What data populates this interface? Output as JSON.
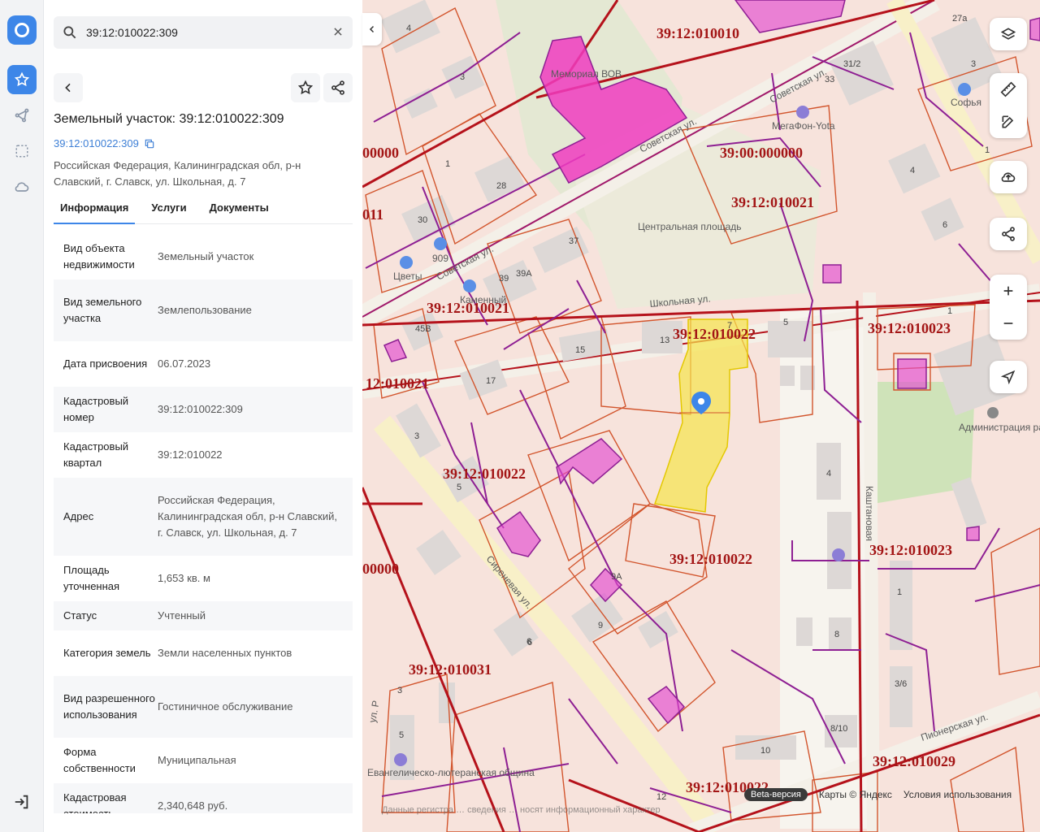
{
  "search": {
    "value": "39:12:010022:309"
  },
  "card": {
    "title": "Земельный участок: 39:12:010022:309",
    "cadastral_link": "39:12:010022:309",
    "address_line": "Российская Федерация, Калининградская обл, р-н Славский, г. Славск, ул. Школьная, д. 7"
  },
  "tabs": [
    "Информация",
    "Услуги",
    "Документы"
  ],
  "info": [
    {
      "k": "Вид объекта недвижимости",
      "v": "Земельный участок"
    },
    {
      "k": "Вид земельного участка",
      "v": "Землепользование"
    },
    {
      "k": "Дата присвоения",
      "v": "06.07.2023"
    },
    {
      "k": "Кадастровый номер",
      "v": "39:12:010022:309"
    },
    {
      "k": "Кадастровый квартал",
      "v": "39:12:010022"
    },
    {
      "k": "Адрес",
      "v": "Российская Федерация, Калининградская обл, р-н Славский, г. Славск, ул. Школьная, д. 7"
    },
    {
      "k": "Площадь уточненная",
      "v": "1,653 кв. м"
    },
    {
      "k": "Статус",
      "v": "Учтенный"
    },
    {
      "k": "Категория земель",
      "v": "Земли населенных пунктов"
    },
    {
      "k": "Вид разрешенного использования",
      "v": "Гостиничное обслуживание"
    },
    {
      "k": "Форма собственности",
      "v": "Муниципальная"
    },
    {
      "k": "Кадастровая стоимость",
      "v": "2,340,648 руб."
    }
  ],
  "map": {
    "quarters": {
      "q1": "39:12:010010",
      "q2": "39:00:000000",
      "q3": "39:12:010021",
      "q4": "39:12:010021",
      "q5": "39:12:010022",
      "q6": "39:12:010023",
      "q7": "12:010021",
      "q8": "39:12:010022",
      "q9": "39:12:010022",
      "q10": "39:12:010023",
      "q11": "39:12:010031",
      "q12": "39:12:010029",
      "q13": "39:12:010022",
      "q14": "00000",
      "q15": "011",
      "q16": "00000"
    },
    "places": {
      "memorial": "Мемориал ВОВ",
      "square": "Центральная площадь",
      "megafon": "МегаФон-Yota",
      "admin": "Администрация района",
      "church": "Евангелическо-лютеранская община",
      "sofya": "Софья",
      "tsvety": "Цветы",
      "kamenny": "Каменный",
      "shop909": "909"
    },
    "streets": {
      "sovetskaya": "Советская ул.",
      "sovetskaya2": "Советская ул.",
      "sovetskaya3": "Советская ул.",
      "shkolnaya": "Школьная ул.",
      "sirenevaya": "Сиреневая ул.",
      "pionerskaya": "Пионерская ул.",
      "kashtanovaya": "Каштановая",
      "ulr": "ул. Р"
    },
    "houses": [
      "4",
      "3",
      "28",
      "1",
      "30",
      "37",
      "39",
      "39А",
      "45В",
      "15",
      "17",
      "13",
      "7",
      "5",
      "3",
      "5",
      "6",
      "9А",
      "9",
      "3",
      "5",
      "12",
      "10",
      "8/10",
      "3/6",
      "8",
      "1",
      "4",
      "31/2",
      "33",
      "3",
      "4",
      "6",
      "1",
      "27а",
      "6",
      "1"
    ]
  },
  "footer": {
    "beta": "Beta-версия",
    "attribution": "Карты © Яндекс",
    "terms": "Условия использования",
    "notice": "Данные регистра … сведения … носят информационный характер"
  }
}
